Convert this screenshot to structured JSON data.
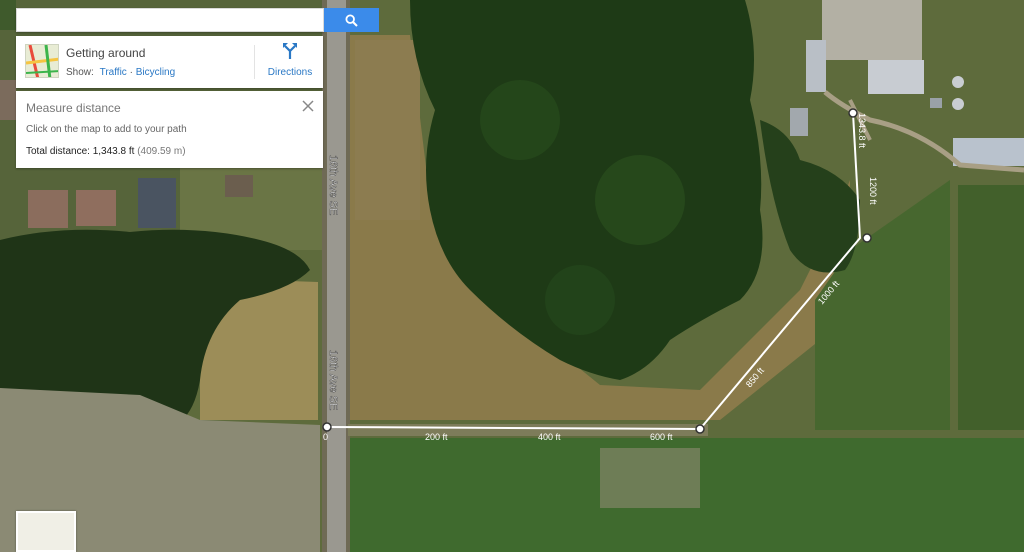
{
  "search": {
    "placeholder": "",
    "value": ""
  },
  "getting_around": {
    "title": "Getting around",
    "show_label": "Show:",
    "traffic_link": "Traffic",
    "separator": " · ",
    "bicycling_link": "Bicycling",
    "directions_label": "Directions"
  },
  "measure": {
    "title": "Measure distance",
    "hint": "Click on the map to add to your path",
    "total_label": "Total distance:",
    "total_ft": "1,343.8 ft",
    "total_m": "(409.59 m)"
  },
  "map": {
    "road_label": "16th Ave SE",
    "path_labels": [
      "0",
      "200 ft",
      "400 ft",
      "600 ft",
      "850 ft",
      "1000 ft",
      "1200 ft",
      "1343.8 ft"
    ]
  },
  "colors": {
    "accent": "#3b8bea",
    "link": "#2a78c5",
    "path": "#ffffff"
  },
  "icons": [
    "search-icon",
    "transit-map-icon",
    "directions-icon",
    "close-icon"
  ]
}
